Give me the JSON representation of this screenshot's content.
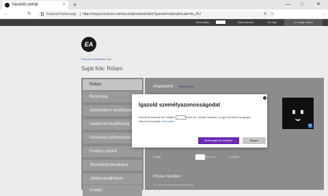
{
  "browser": {
    "tab_title": "Vásárlói portál",
    "tab_close": "×",
    "new_tab": "+",
    "win_min": "—",
    "win_max": "□",
    "win_close": "✕",
    "back": "←",
    "refresh": "↻",
    "security_label": "Folyosztt biztonság",
    "url": "https://myaccount.ea.com/cp-ui/aboutme/index?gameId=ebiou&locale=hu_HU",
    "read_aloud": "A",
    "favorite": "☆",
    "more": "…"
  },
  "ea_topbar": {
    "greeting": "Üdvözöljük,",
    "logout": "Kijelentkezés",
    "sign_in": "EA Sign",
    "origin_btn": "Az Origin kliens"
  },
  "page": {
    "logo": "EA",
    "breadcrumb_link": "Fiókod beállításai",
    "breadcrumb_current": "/ EA fiók",
    "title": "Saját fiók: Rólam"
  },
  "sidebar": {
    "items": [
      {
        "label": "Rólam"
      },
      {
        "label": "Biztonság"
      },
      {
        "label": "Adatvédelmi beállítások"
      },
      {
        "label": "Levelezési beállítások"
      },
      {
        "label": "Rendelési előzmények"
      },
      {
        "label": "Fizetési módok"
      },
      {
        "label": "Termékkód beváltása"
      },
      {
        "label": "Játékosbeállítások"
      },
      {
        "label": "Család"
      }
    ]
  },
  "main": {
    "heading": "Alapadatok",
    "edit_link": "Szerkesztés",
    "email_label": "E-mail",
    "email_domain": "indes.hu",
    "email_verified": "✓ Verified",
    "phone_heading": "Phone Number",
    "phone_sub": "You do not have a phone number"
  },
  "dialog": {
    "title": "Igazold személyazonosságodat",
    "close": "×",
    "text_before": "Ellenőrző kódodat ide küldjük:",
    "email_domain": "indes.hu",
    "text_after": ". Kérjük, folytasd, ha így szeretnéd megkapni ellenőrző kódodat.",
    "change_link": "Módosítás",
    "send_button": "Biztonsági kód küldése",
    "cancel_button": "Mégse"
  },
  "colors": {
    "accent_purple": "#6a2bb5",
    "overlay_gray": "#8c8c8c",
    "ea_bar": "#3d3d3d"
  }
}
